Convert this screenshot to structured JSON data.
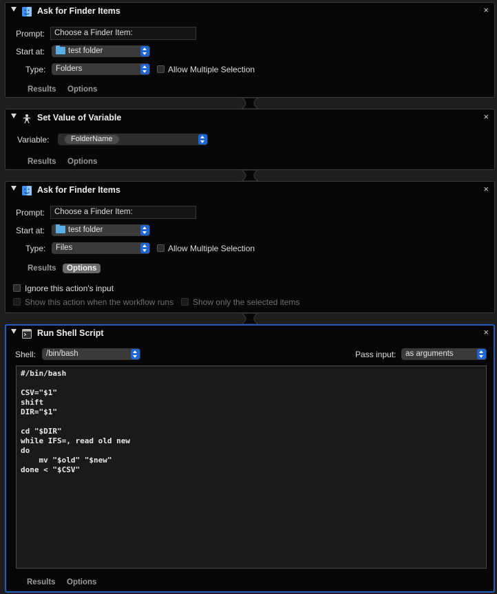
{
  "actions": [
    {
      "title": "Ask for Finder Items",
      "prompt_label": "Prompt:",
      "prompt_value": "Choose a Finder Item:",
      "start_label": "Start at:",
      "start_value": "test folder",
      "type_label": "Type:",
      "type_value": "Folders",
      "allow_multiple_label": "Allow Multiple Selection",
      "results_label": "Results",
      "options_label": "Options"
    },
    {
      "title": "Set Value of Variable",
      "variable_label": "Variable:",
      "variable_value": "FolderName",
      "results_label": "Results",
      "options_label": "Options"
    },
    {
      "title": "Ask for Finder Items",
      "prompt_label": "Prompt:",
      "prompt_value": "Choose a Finder Item:",
      "start_label": "Start at:",
      "start_value": "test folder",
      "type_label": "Type:",
      "type_value": "Files",
      "allow_multiple_label": "Allow Multiple Selection",
      "results_label": "Results",
      "options_label": "Options",
      "ignore_input_label": "Ignore this action's input",
      "show_when_runs_label": "Show this action when the workflow runs",
      "show_selected_label": "Show only the selected items"
    },
    {
      "title": "Run Shell Script",
      "shell_label": "Shell:",
      "shell_value": "/bin/bash",
      "pass_input_label": "Pass input:",
      "pass_input_value": "as arguments",
      "script": "#/bin/bash\n\nCSV=\"$1\"\nshift\nDIR=\"$1\"\n\ncd \"$DIR\"\nwhile IFS=, read old new\ndo\n    mv \"$old\" \"$new\"\ndone < \"$CSV\"",
      "results_label": "Results",
      "options_label": "Options"
    }
  ],
  "icons": {
    "finder": "finder-icon",
    "variable": "variable-icon",
    "terminal": "terminal-icon",
    "close": "close-icon",
    "disclosure": "disclosure-triangle-icon",
    "folder": "folder-icon"
  },
  "colors": {
    "background": "#1e1e1e",
    "panel": "#070707",
    "selection_border": "#1f5fbd",
    "popup_stepper": "#1e66d6",
    "folder": "#5ab0e6"
  },
  "close_glyph": "×"
}
